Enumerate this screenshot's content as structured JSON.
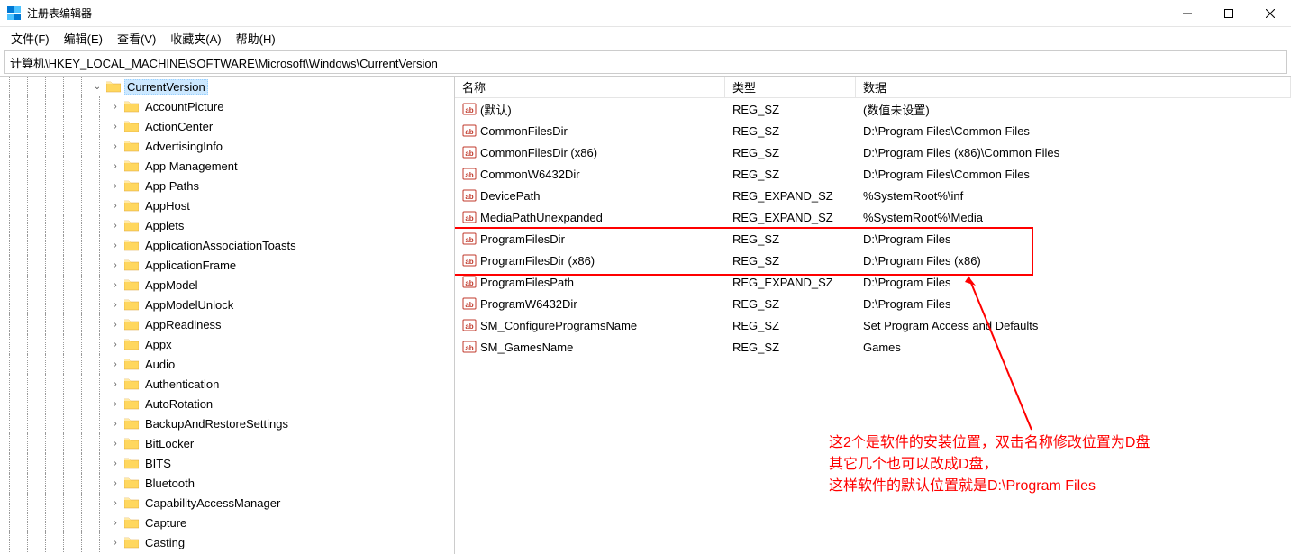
{
  "window": {
    "title": "注册表编辑器"
  },
  "menu": {
    "file": "文件(F)",
    "edit": "编辑(E)",
    "view": "查看(V)",
    "favorites": "收藏夹(A)",
    "help": "帮助(H)"
  },
  "address": "计算机\\HKEY_LOCAL_MACHINE\\SOFTWARE\\Microsoft\\Windows\\CurrentVersion",
  "tree": {
    "selected": "CurrentVersion",
    "children": [
      "AccountPicture",
      "ActionCenter",
      "AdvertisingInfo",
      "App Management",
      "App Paths",
      "AppHost",
      "Applets",
      "ApplicationAssociationToasts",
      "ApplicationFrame",
      "AppModel",
      "AppModelUnlock",
      "AppReadiness",
      "Appx",
      "Audio",
      "Authentication",
      "AutoRotation",
      "BackupAndRestoreSettings",
      "BitLocker",
      "BITS",
      "Bluetooth",
      "CapabilityAccessManager",
      "Capture",
      "Casting"
    ]
  },
  "columns": {
    "name": "名称",
    "type": "类型",
    "data": "数据"
  },
  "values": [
    {
      "name": "(默认)",
      "type": "REG_SZ",
      "data": "(数值未设置)"
    },
    {
      "name": "CommonFilesDir",
      "type": "REG_SZ",
      "data": "D:\\Program Files\\Common Files"
    },
    {
      "name": "CommonFilesDir (x86)",
      "type": "REG_SZ",
      "data": "D:\\Program Files (x86)\\Common Files"
    },
    {
      "name": "CommonW6432Dir",
      "type": "REG_SZ",
      "data": "D:\\Program Files\\Common Files"
    },
    {
      "name": "DevicePath",
      "type": "REG_EXPAND_SZ",
      "data": "%SystemRoot%\\inf"
    },
    {
      "name": "MediaPathUnexpanded",
      "type": "REG_EXPAND_SZ",
      "data": "%SystemRoot%\\Media"
    },
    {
      "name": "ProgramFilesDir",
      "type": "REG_SZ",
      "data": "D:\\Program Files"
    },
    {
      "name": "ProgramFilesDir (x86)",
      "type": "REG_SZ",
      "data": "D:\\Program Files (x86)"
    },
    {
      "name": "ProgramFilesPath",
      "type": "REG_EXPAND_SZ",
      "data": "D:\\Program Files"
    },
    {
      "name": "ProgramW6432Dir",
      "type": "REG_SZ",
      "data": "D:\\Program Files"
    },
    {
      "name": "SM_ConfigureProgramsName",
      "type": "REG_SZ",
      "data": "Set Program Access and Defaults"
    },
    {
      "name": "SM_GamesName",
      "type": "REG_SZ",
      "data": "Games"
    }
  ],
  "annotation": {
    "line1": "这2个是软件的安装位置，双击名称修改位置为D盘",
    "line2": "其它几个也可以改成D盘，",
    "line3": "这样软件的默认位置就是D:\\Program Files"
  }
}
